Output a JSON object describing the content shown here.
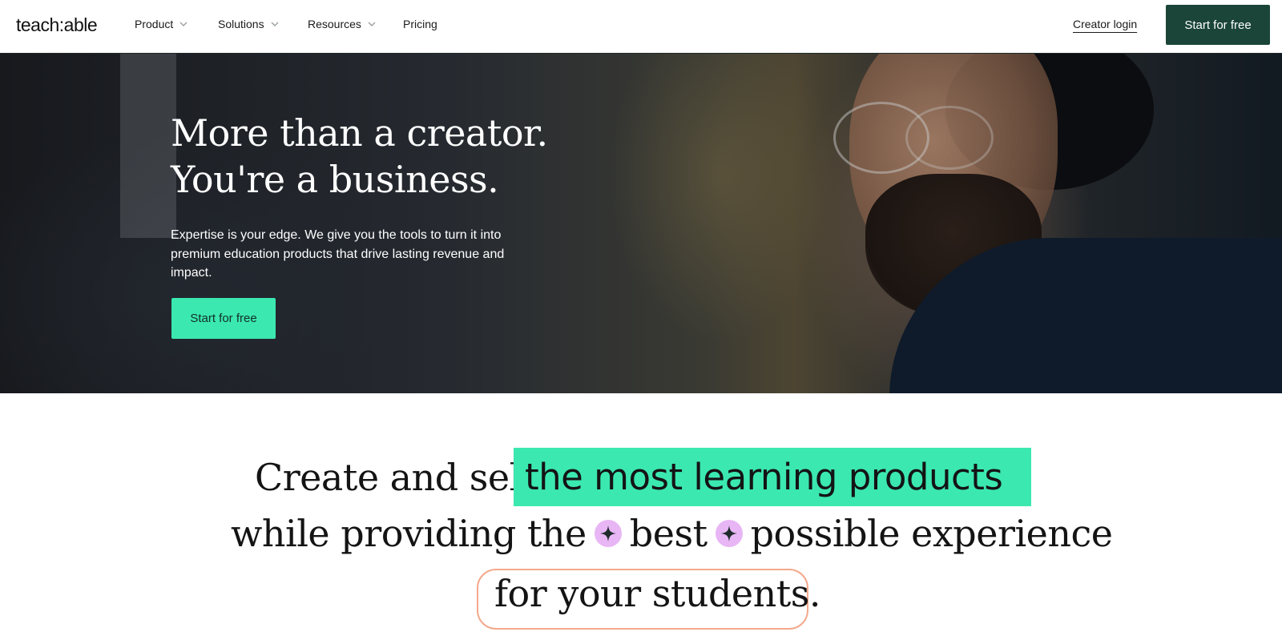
{
  "nav": {
    "logo": "teach:able",
    "items": [
      {
        "label": "Product",
        "dropdown": true
      },
      {
        "label": "Solutions",
        "dropdown": true
      },
      {
        "label": "Resources",
        "dropdown": true
      },
      {
        "label": "Pricing",
        "dropdown": false
      }
    ],
    "login_label": "Creator login",
    "cta_label": "Start for free"
  },
  "hero": {
    "title_line1": "More than a creator.",
    "title_line2": "You're a business.",
    "subtitle": "Expertise is your edge. We give you the tools to turn it into premium education products that drive lasting revenue and impact.",
    "cta_label": "Start for free"
  },
  "statement": {
    "line1_prefix": "Create and sell",
    "line1_highlight": "the most learning products",
    "line2_part1": "while providing the",
    "line2_part2": "best",
    "line2_part3": "possible experience",
    "line3": "for your students."
  },
  "colors": {
    "brand_dark": "#1a4538",
    "accent_mint": "#3be8b0",
    "spark_bg": "#e8b6f5",
    "pill_border": "#f4a98c"
  },
  "icons": [
    "chevron-down-icon",
    "sparkle-icon"
  ]
}
